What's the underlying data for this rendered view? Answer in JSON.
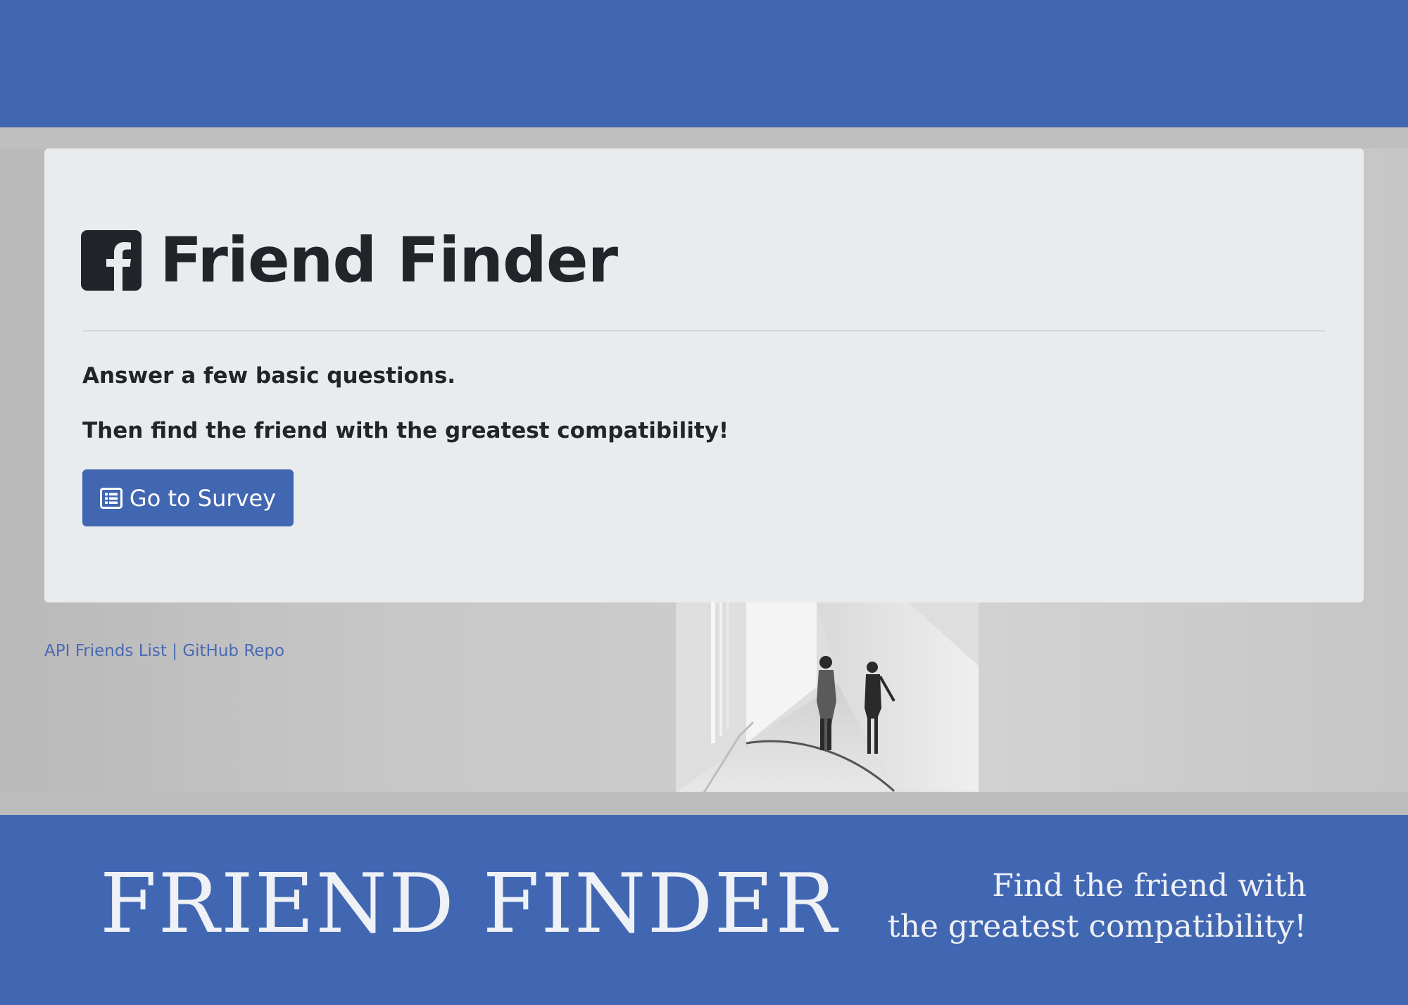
{
  "jumbotron": {
    "title": "Friend Finder",
    "lead_line_1": "Answer a few basic questions.",
    "lead_line_2": "Then find the friend with the greatest compatibility!",
    "survey_button_label": "Go to Survey"
  },
  "footer": {
    "link_api": "API Friends List",
    "separator": "|",
    "link_github": "GitHub Repo"
  },
  "banner": {
    "title": "FRIEND FINDER",
    "tagline_line_1": "Find the friend with",
    "tagline_line_2": "the greatest compatibility!"
  },
  "colors": {
    "brand_blue": "#4267b2",
    "panel_bg": "#e9ecef",
    "text_dark": "#212529"
  },
  "icons": {
    "brand": "facebook-square-icon",
    "button": "list-alt-icon"
  }
}
